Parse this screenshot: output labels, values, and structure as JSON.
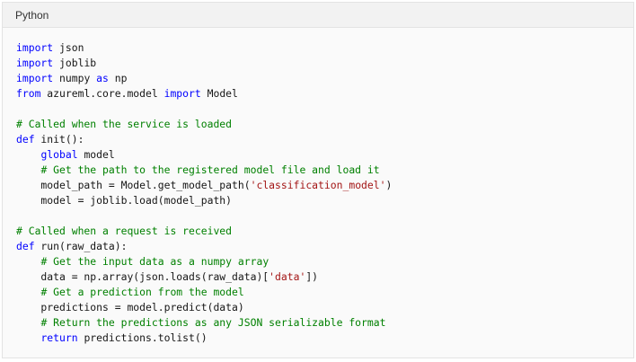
{
  "code_block": {
    "language": "Python",
    "lines": [
      [
        {
          "t": "kw",
          "v": "import"
        },
        {
          "t": "tx",
          "v": " json"
        }
      ],
      [
        {
          "t": "kw",
          "v": "import"
        },
        {
          "t": "tx",
          "v": " joblib"
        }
      ],
      [
        {
          "t": "kw",
          "v": "import"
        },
        {
          "t": "tx",
          "v": " numpy "
        },
        {
          "t": "kw",
          "v": "as"
        },
        {
          "t": "tx",
          "v": " np"
        }
      ],
      [
        {
          "t": "kw",
          "v": "from"
        },
        {
          "t": "tx",
          "v": " azureml.core.model "
        },
        {
          "t": "kw",
          "v": "import"
        },
        {
          "t": "tx",
          "v": " Model"
        }
      ],
      [],
      [
        {
          "t": "cm",
          "v": "# Called when the service is loaded"
        }
      ],
      [
        {
          "t": "kw",
          "v": "def"
        },
        {
          "t": "tx",
          "v": " init():"
        }
      ],
      [
        {
          "t": "tx",
          "v": "    "
        },
        {
          "t": "kw",
          "v": "global"
        },
        {
          "t": "tx",
          "v": " model"
        }
      ],
      [
        {
          "t": "tx",
          "v": "    "
        },
        {
          "t": "cm",
          "v": "# Get the path to the registered model file and load it"
        }
      ],
      [
        {
          "t": "tx",
          "v": "    model_path = Model.get_model_path("
        },
        {
          "t": "st",
          "v": "'classification_model'"
        },
        {
          "t": "tx",
          "v": ")"
        }
      ],
      [
        {
          "t": "tx",
          "v": "    model = joblib.load(model_path)"
        }
      ],
      [],
      [
        {
          "t": "cm",
          "v": "# Called when a request is received"
        }
      ],
      [
        {
          "t": "kw",
          "v": "def"
        },
        {
          "t": "tx",
          "v": " run(raw_data):"
        }
      ],
      [
        {
          "t": "tx",
          "v": "    "
        },
        {
          "t": "cm",
          "v": "# Get the input data as a numpy array"
        }
      ],
      [
        {
          "t": "tx",
          "v": "    data = np.array(json.loads(raw_data)["
        },
        {
          "t": "st",
          "v": "'data'"
        },
        {
          "t": "tx",
          "v": "])"
        }
      ],
      [
        {
          "t": "tx",
          "v": "    "
        },
        {
          "t": "cm",
          "v": "# Get a prediction from the model"
        }
      ],
      [
        {
          "t": "tx",
          "v": "    predictions = model.predict(data)"
        }
      ],
      [
        {
          "t": "tx",
          "v": "    "
        },
        {
          "t": "cm",
          "v": "# Return the predictions as any JSON serializable format"
        }
      ],
      [
        {
          "t": "tx",
          "v": "    "
        },
        {
          "t": "kw",
          "v": "return"
        },
        {
          "t": "tx",
          "v": " predictions.tolist()"
        }
      ]
    ]
  },
  "colors": {
    "keyword": "#0000ff",
    "comment": "#008000",
    "string": "#a31515",
    "text": "#161616",
    "background": "#fafafa",
    "header_background": "#f2f2f2",
    "border": "#e3e3e3"
  }
}
